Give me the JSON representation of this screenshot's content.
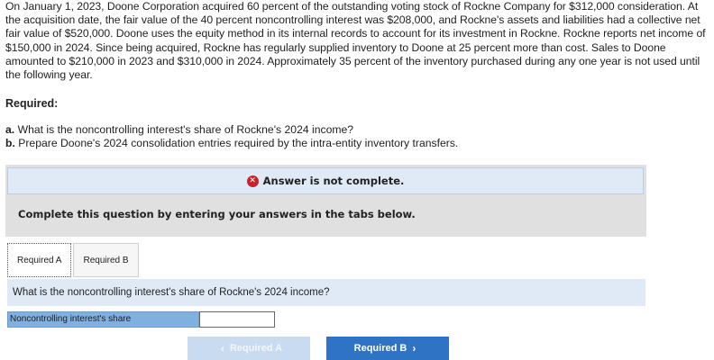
{
  "problem": {
    "paragraph": "On January 1, 2023, Doone Corporation acquired 60 percent of the outstanding voting stock of Rockne Company for $312,000 consideration. At the acquisition date, the fair value of the 40 percent noncontrolling interest was $208,000, and Rockne's assets and liabilities had a collective net fair value of $520,000. Doone uses the equity method in its internal records to account for its investment in Rockne. Rockne reports net income of $150,000 in 2024. Since being acquired, Rockne has regularly supplied inventory to Doone at 25 percent more than cost. Sales to Doone amounted to $210,000 in 2023 and $310,000 in 2024. Approximately 35 percent of the inventory purchased during any one year is not used until the following year."
  },
  "required": {
    "heading": "Required:",
    "items": [
      {
        "marker": "a.",
        "text": "What is the noncontrolling interest's share of Rockne's 2024 income?"
      },
      {
        "marker": "b.",
        "text": "Prepare Doone's 2024 consolidation entries required by the intra-entity inventory transfers."
      }
    ]
  },
  "status": {
    "icon": "error-x-icon",
    "text": "Answer is not complete."
  },
  "instructions": "Complete this question by entering your answers in the tabs below.",
  "tabs": [
    {
      "label": "Required A",
      "active": true
    },
    {
      "label": "Required B",
      "active": false
    }
  ],
  "panel": {
    "question": "What is the noncontrolling interest's share of Rockne's 2024 income?",
    "row_label": "Noncontrolling interest's share",
    "answer_value": ""
  },
  "navigation": {
    "prev_label": "Required A",
    "next_label": "Required B"
  }
}
